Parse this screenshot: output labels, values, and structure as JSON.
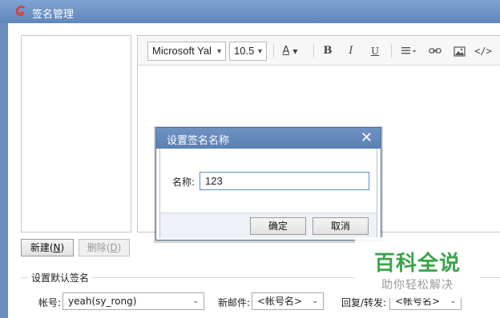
{
  "window": {
    "title": "签名管理",
    "icon": "app-logo-icon"
  },
  "toolbar": {
    "font_family": "Microsoft Yal",
    "font_size": "10.5",
    "font_color_glyph": "A",
    "bold_glyph": "B",
    "italic_glyph": "I",
    "underline_glyph": "U",
    "icons": [
      "font-color-icon",
      "bold-icon",
      "italic-icon",
      "underline-icon",
      "align-icon",
      "link-icon",
      "image-icon",
      "source-code-icon"
    ]
  },
  "buttons": {
    "new_label": "新建(",
    "new_key": "N",
    "new_suffix": ")",
    "delete_label": "删除(",
    "delete_key": "D",
    "delete_suffix": ")"
  },
  "defaults_group": {
    "title": "设置默认签名",
    "account_label": "帐号:",
    "account_value": "yeah(sy_rong)",
    "new_mail_label": "新邮件:",
    "new_mail_value": "<帐号名>",
    "reply_label": "回复/转发:",
    "reply_value": "<帐号名>"
  },
  "dialog": {
    "title": "设置签名名称",
    "name_label": "名称:",
    "name_value": "123",
    "ok_label": "确定",
    "cancel_label": "取消"
  },
  "watermark": {
    "main": "百科全说",
    "sub": "助你轻松解决"
  },
  "colors": {
    "titlebar": "#6a8fbf",
    "watermark_green": "#3aa54a",
    "logo_red": "#e03a2f"
  }
}
